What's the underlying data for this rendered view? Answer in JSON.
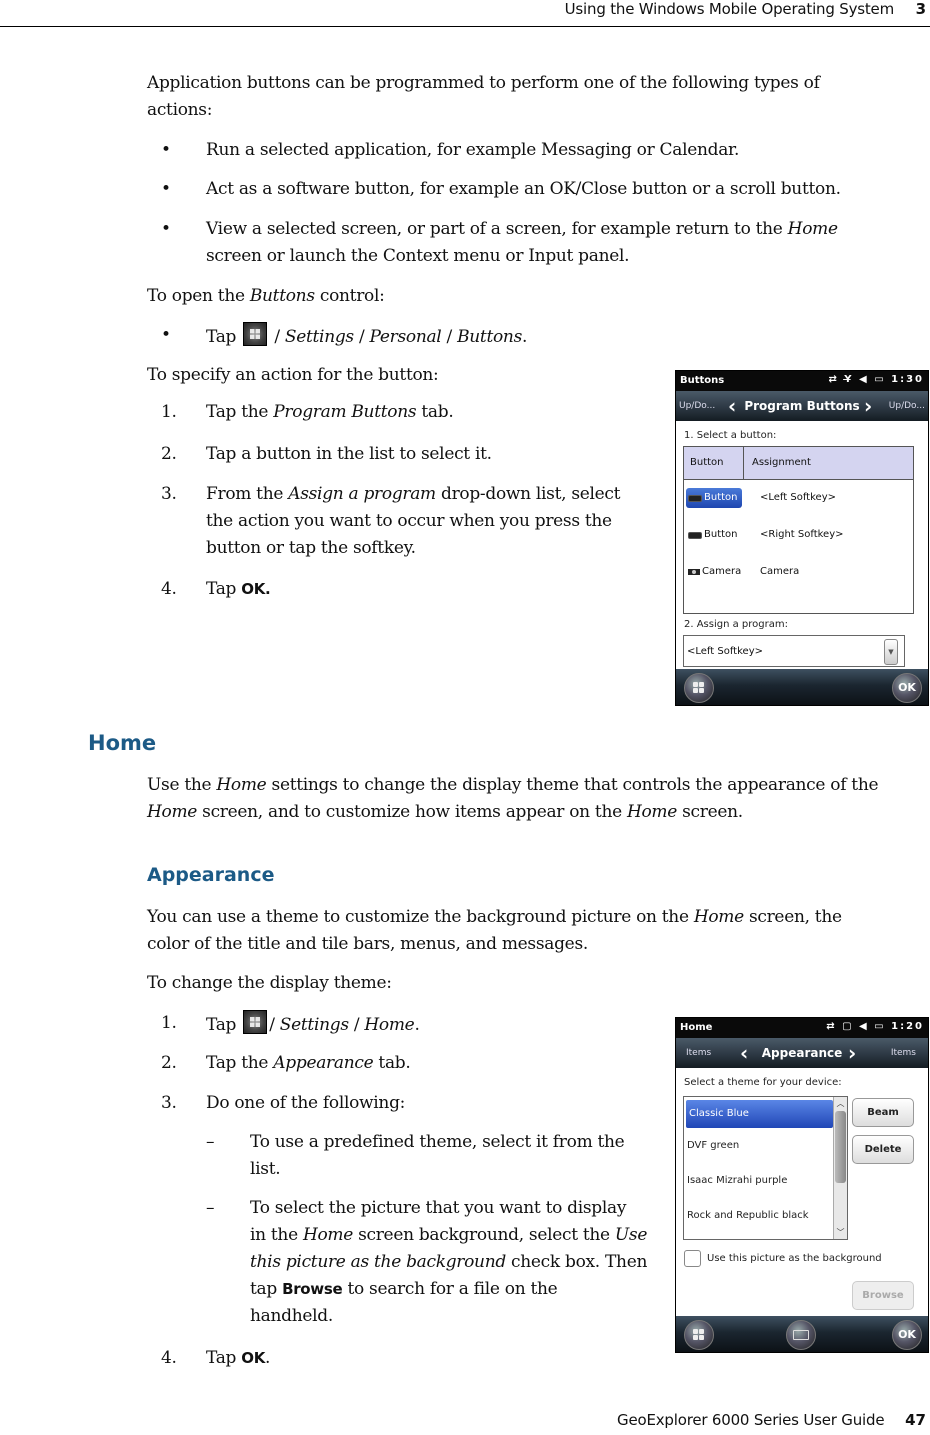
{
  "running_head": {
    "title": "Using the Windows Mobile Operating System",
    "chapter": "3"
  },
  "footer": {
    "guide": "GeoExplorer 6000 Series User Guide",
    "page": "47"
  },
  "intro": {
    "text": "Application buttons can be programmed to perform one of the following types of actions:",
    "line1": "Application buttons can be programmed to perform one of the following types of",
    "line2": "actions:",
    "bullets": [
      {
        "text": "Run a selected application, for example Messaging or Calendar."
      },
      {
        "text": "Act as a software button, for example an OK/Close button or a scroll button."
      },
      {
        "line1_a": "View a selected screen, or part of a screen, for example return to the ",
        "line1_em": "Home",
        "line2": "screen or launch the Context menu or Input panel."
      }
    ]
  },
  "open_buttons": {
    "lead_a": "To open the ",
    "lead_em": "Buttons",
    "lead_b": " control:",
    "step": {
      "tap": "Tap",
      "path_a": " / ",
      "path_1": "Settings",
      "sep": " / ",
      "path_2": "Personal",
      "path_3": "Buttons",
      "end": "."
    }
  },
  "specify_action": {
    "lead": "To specify an action for the button:",
    "steps": [
      {
        "num": "1.",
        "a": "Tap the ",
        "em": "Program Buttons",
        "b": " tab."
      },
      {
        "num": "2.",
        "text": "Tap a button in the list to select it."
      },
      {
        "num": "3.",
        "a": "From the ",
        "em": "Assign a program",
        "b": " drop-down list, select",
        "line2": "the action you want to occur when you press the",
        "line3": "button or tap the softkey."
      },
      {
        "num": "4.",
        "a": "Tap ",
        "bold": "OK."
      }
    ]
  },
  "buttons_screen": {
    "app_title": "Buttons",
    "status_icons": "⇄ Y̶ ◀ ▭",
    "time": "1:30",
    "tab_left": "Up/Do...",
    "tab_current": "Program Buttons",
    "tab_right": "Up/Do...",
    "select_label": "1. Select a button:",
    "columns": [
      "Button",
      "Assignment"
    ],
    "rows": [
      {
        "button": "Button",
        "assignment": "<Left Softkey>",
        "selected": true
      },
      {
        "button": "Button",
        "assignment": "<Right Softkey>",
        "selected": false
      },
      {
        "button": "Camera",
        "assignment": "Camera",
        "selected": false
      }
    ],
    "assign_label": "2. Assign a program:",
    "assign_value": "<Left Softkey>",
    "ok": "OK"
  },
  "home_section": {
    "heading": "Home",
    "line1_a": "Use the ",
    "line1_em": "Home",
    "line1_b": " settings to change the display theme that controls the appearance of the",
    "line2_em": "Home",
    "line2_b": " screen, and to customize how items appear on the ",
    "line2_em2": "Home",
    "line2_c": " screen."
  },
  "appearance_section": {
    "heading": "Appearance",
    "line1_a": "You can use a theme to customize the background picture on the ",
    "line1_em": "Home",
    "line1_b": " screen, the",
    "line2": "color of the title and tile bars, menus, and messages.",
    "lead": "To change the display theme:",
    "steps": [
      {
        "num": "1.",
        "tap": "Tap",
        "sep1": "/ ",
        "p1": "Settings",
        "sep2": " / ",
        "p2": "Home",
        "end": "."
      },
      {
        "num": "2.",
        "a": "Tap the ",
        "em": "Appearance",
        "b": " tab."
      },
      {
        "num": "3.",
        "text": "Do one of the following:"
      },
      {
        "num": "4.",
        "a": "Tap ",
        "bold": "OK",
        "b": "."
      }
    ],
    "substeps": [
      {
        "dash": "–",
        "line1": "To use a predefined theme, select it from the",
        "line2": "list."
      },
      {
        "dash": "–",
        "l1": "To select the picture that you want to display",
        "l2_a": "in the ",
        "l2_em": "Home",
        "l2_b": " screen background, select the ",
        "l2_em2": "Use",
        "l3_em": "this picture as the background",
        "l3_b": " check box. Then",
        "l4_a": "tap ",
        "l4_bold": "Browse",
        "l4_b": " to search for a file on the",
        "l5": "handheld."
      }
    ]
  },
  "home_screen": {
    "app_title": "Home",
    "status_icons": "⇄ ▢ ◀ ▭",
    "time": "1:20",
    "tab_left": "Items",
    "tab_current": "Appearance",
    "tab_right": "Items",
    "select_label": "Select a theme for your device:",
    "themes": [
      {
        "name": "Classic Blue",
        "selected": true
      },
      {
        "name": "DVF green",
        "selected": false
      },
      {
        "name": "Isaac Mizrahi purple",
        "selected": false
      },
      {
        "name": "Rock and Republic black",
        "selected": false
      }
    ],
    "beam": "Beam",
    "delete": "Delete",
    "checkbox_label": "Use this picture as the background",
    "checkbox_checked": false,
    "browse": "Browse",
    "ok": "OK"
  }
}
